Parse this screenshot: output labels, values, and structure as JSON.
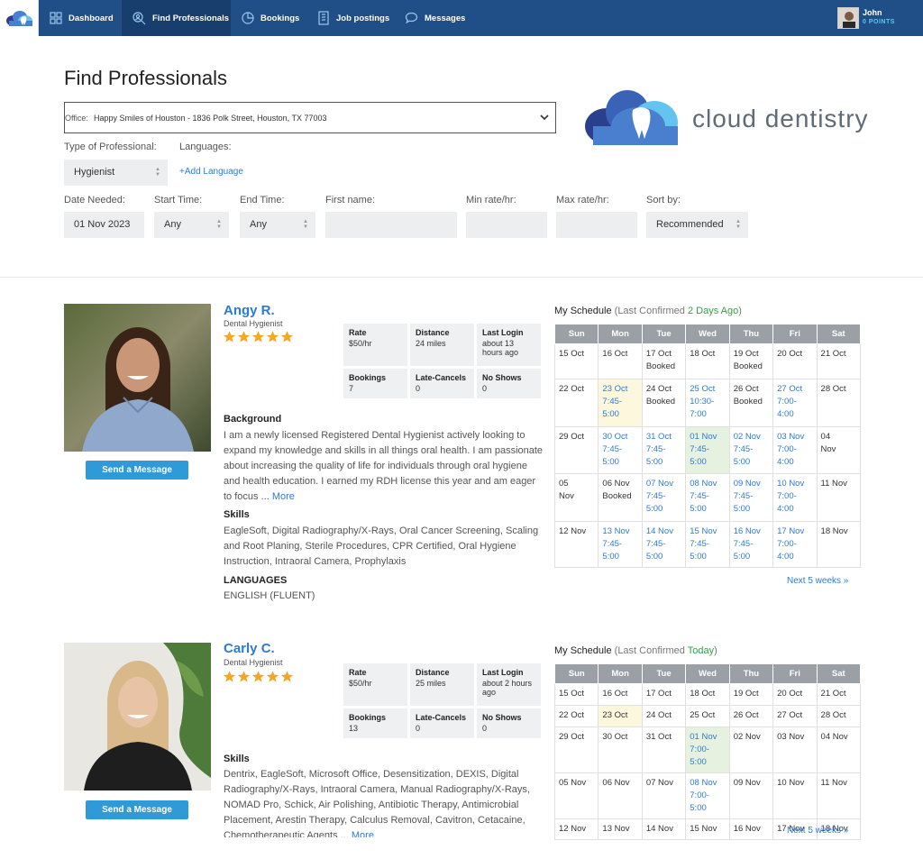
{
  "nav": {
    "items": [
      {
        "label": "Dashboard",
        "icon": "grid-icon"
      },
      {
        "label": "Find Professionals",
        "icon": "search-person-icon"
      },
      {
        "label": "Bookings",
        "icon": "pie-icon"
      },
      {
        "label": "Job postings",
        "icon": "building-icon"
      },
      {
        "label": "Messages",
        "icon": "chat-icon"
      }
    ],
    "user": {
      "name": "John",
      "points": "0 POINTS"
    }
  },
  "page": {
    "title": "Find Professionals"
  },
  "search": {
    "office_label": "Office:",
    "office_value": "Happy Smiles of Houston - 1836 Polk Street, Houston, TX 77003",
    "type_label": "Type of Professional:",
    "type_value": "Hygienist",
    "languages_label": "Languages:",
    "add_language": "+Add Language",
    "date_label": "Date Needed:",
    "date_value": "01 Nov 2023",
    "start_label": "Start Time:",
    "start_value": "Any",
    "end_label": "End Time:",
    "end_value": "Any",
    "first_name_label": "First name:",
    "min_rate_label": "Min rate/hr:",
    "max_rate_label": "Max rate/hr:",
    "sort_label": "Sort by:",
    "sort_value": "Recommended"
  },
  "brand": {
    "name": "cloud dentistry",
    "colors": [
      "#2b3f8f",
      "#4a7fd0",
      "#63c5ef"
    ]
  },
  "colors": {
    "nav": "#1f4f86",
    "accent": "#2b7bd6",
    "button": "#2f9ad8",
    "star": "#f5a623",
    "confirmed": "#2ea34a"
  },
  "professionals": [
    {
      "name": "Angy R.",
      "role": "Dental Hygienist",
      "rating": 5,
      "message_button": "Send a Message",
      "stats": [
        {
          "k": "Rate",
          "v": "$50/hr"
        },
        {
          "k": "Distance",
          "v": "24 miles"
        },
        {
          "k": "Last Login",
          "v": "about 13 hours ago"
        },
        {
          "k": "Bookings",
          "v": "7"
        },
        {
          "k": "Late-Cancels",
          "v": "0"
        },
        {
          "k": "No Shows",
          "v": "0"
        }
      ],
      "background_title": "Background",
      "background": "I am a newly licensed Registered Dental Hygienist actively looking to expand my knowledge and skills in all things oral health. I am passionate about increasing the quality of life for individuals through oral hygiene and health education. I earned my RDH license this year and am eager to focus ...",
      "more": "More",
      "skills_title": "Skills",
      "skills": "EagleSoft, Digital Radiography/X-Rays, Oral Cancer Screening, Scaling and Root Planing, Sterile Procedures, CPR Certified, Oral Hygiene Instruction, Intraoral Camera, Prophylaxis",
      "languages_title": "LANGUAGES",
      "languages": "ENGLISH (FLUENT)",
      "schedule": {
        "title": "My Schedule",
        "confirmed_prefix": "(Last Confirmed",
        "confirmed_value": "2 Days Ago",
        "confirmed_suffix": ")",
        "days": [
          "Sun",
          "Mon",
          "Tue",
          "Wed",
          "Thu",
          "Fri",
          "Sat"
        ],
        "rows": [
          [
            {
              "t": "15 Oct"
            },
            {
              "t": "16 Oct"
            },
            {
              "t": "17 Oct\nBooked"
            },
            {
              "t": "18 Oct"
            },
            {
              "t": "19 Oct\nBooked"
            },
            {
              "t": "20 Oct"
            },
            {
              "t": "21 Oct"
            }
          ],
          [
            {
              "t": "22 Oct"
            },
            {
              "t": "23 Oct\n7:45-\n5:00",
              "s": "avail yel"
            },
            {
              "t": "24 Oct\nBooked"
            },
            {
              "t": "25 Oct\n10:30-\n7:00",
              "s": "avail"
            },
            {
              "t": "26 Oct\nBooked"
            },
            {
              "t": "27 Oct\n7:00-\n4:00",
              "s": "avail"
            },
            {
              "t": "28 Oct"
            }
          ],
          [
            {
              "t": "29 Oct"
            },
            {
              "t": "30 Oct\n7:45-\n5:00",
              "s": "avail"
            },
            {
              "t": "31 Oct\n7:45-\n5:00",
              "s": "avail"
            },
            {
              "t": "01 Nov\n7:45-5:00",
              "s": "avail grn"
            },
            {
              "t": "02 Nov\n7:45-\n5:00",
              "s": "avail"
            },
            {
              "t": "03 Nov\n7:00-\n4:00",
              "s": "avail"
            },
            {
              "t": "04\nNov"
            }
          ],
          [
            {
              "t": "05\nNov"
            },
            {
              "t": "06 Nov\nBooked"
            },
            {
              "t": "07 Nov\n7:45-\n5:00",
              "s": "avail"
            },
            {
              "t": "08 Nov\n7:45-5:00",
              "s": "avail"
            },
            {
              "t": "09 Nov\n7:45-\n5:00",
              "s": "avail"
            },
            {
              "t": "10 Nov\n7:00-\n4:00",
              "s": "avail"
            },
            {
              "t": "11 Nov"
            }
          ],
          [
            {
              "t": "12 Nov"
            },
            {
              "t": "13 Nov\n7:45-\n5:00",
              "s": "avail"
            },
            {
              "t": "14 Nov\n7:45-\n5:00",
              "s": "avail"
            },
            {
              "t": "15 Nov\n7:45-5:00",
              "s": "avail"
            },
            {
              "t": "16 Nov\n7:45-\n5:00",
              "s": "avail"
            },
            {
              "t": "17 Nov\n7:00-\n4:00",
              "s": "avail"
            },
            {
              "t": "18 Nov"
            }
          ]
        ],
        "next": "Next 5 weeks »"
      }
    },
    {
      "name": "Carly C.",
      "role": "Dental Hygienist",
      "rating": 5,
      "message_button": "Send a Message",
      "stats": [
        {
          "k": "Rate",
          "v": "$50/hr"
        },
        {
          "k": "Distance",
          "v": "25 miles"
        },
        {
          "k": "Last Login",
          "v": "about 2 hours ago"
        },
        {
          "k": "Bookings",
          "v": "13"
        },
        {
          "k": "Late-Cancels",
          "v": "0"
        },
        {
          "k": "No Shows",
          "v": "0"
        }
      ],
      "skills_title": "Skills",
      "skills": "Dentrix, EagleSoft, Microsoft Office, Desensitization, DEXIS, Digital Radiography/X-Rays, Intraoral Camera, Manual Radiography/X-Rays, NOMAD Pro, Schick, Air Polishing, Antibiotic Therapy, Antimicrobial Placement, Arestin Therapy, Calculus Removal, Cavitron, Cetacaine, Chemotherapeutic Agents ...",
      "more": "More",
      "schedule": {
        "title": "My Schedule",
        "confirmed_prefix": "(Last Confirmed",
        "confirmed_value": "Today",
        "confirmed_suffix": ")",
        "days": [
          "Sun",
          "Mon",
          "Tue",
          "Wed",
          "Thu",
          "Fri",
          "Sat"
        ],
        "rows": [
          [
            {
              "t": "15 Oct"
            },
            {
              "t": "16 Oct"
            },
            {
              "t": "17 Oct"
            },
            {
              "t": "18 Oct"
            },
            {
              "t": "19 Oct"
            },
            {
              "t": "20 Oct"
            },
            {
              "t": "21 Oct"
            }
          ],
          [
            {
              "t": "22 Oct"
            },
            {
              "t": "23 Oct",
              "s": "yel"
            },
            {
              "t": "24 Oct"
            },
            {
              "t": "25 Oct"
            },
            {
              "t": "26 Oct"
            },
            {
              "t": "27 Oct"
            },
            {
              "t": "28 Oct"
            }
          ],
          [
            {
              "t": "29 Oct"
            },
            {
              "t": "30 Oct"
            },
            {
              "t": "31 Oct"
            },
            {
              "t": "01 Nov\n7:00-5:00",
              "s": "avail grn"
            },
            {
              "t": "02 Nov"
            },
            {
              "t": "03 Nov"
            },
            {
              "t": "04 Nov"
            }
          ],
          [
            {
              "t": "05 Nov"
            },
            {
              "t": "06 Nov"
            },
            {
              "t": "07 Nov"
            },
            {
              "t": "08 Nov\n7:00-5:00",
              "s": "avail"
            },
            {
              "t": "09 Nov"
            },
            {
              "t": "10 Nov"
            },
            {
              "t": "11 Nov"
            }
          ],
          [
            {
              "t": "12 Nov"
            },
            {
              "t": "13 Nov"
            },
            {
              "t": "14 Nov"
            },
            {
              "t": "15 Nov"
            },
            {
              "t": "16 Nov"
            },
            {
              "t": "17 Nov"
            },
            {
              "t": "18 Nov"
            }
          ]
        ],
        "next": "Next 5 weeks »"
      }
    }
  ]
}
